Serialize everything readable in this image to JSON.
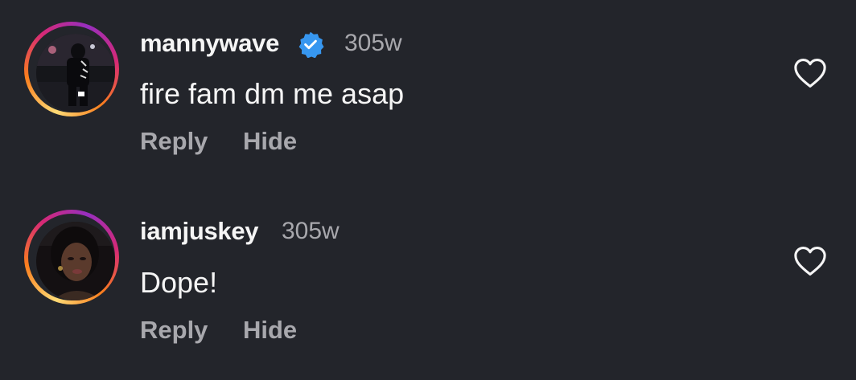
{
  "comments": [
    {
      "username": "mannywave",
      "verified": true,
      "time": "305w",
      "text": "fire fam dm me asap",
      "reply_label": "Reply",
      "hide_label": "Hide"
    },
    {
      "username": "iamjuskey",
      "verified": false,
      "time": "305w",
      "text": "Dope!",
      "reply_label": "Reply",
      "hide_label": "Hide"
    }
  ],
  "colors": {
    "background": "#23252b",
    "text": "#f5f5f5",
    "muted": "#a8a8ad",
    "verified_badge": "#3797f0"
  },
  "icons": {
    "like": "heart-outline-icon",
    "verified": "verified-badge-icon"
  }
}
